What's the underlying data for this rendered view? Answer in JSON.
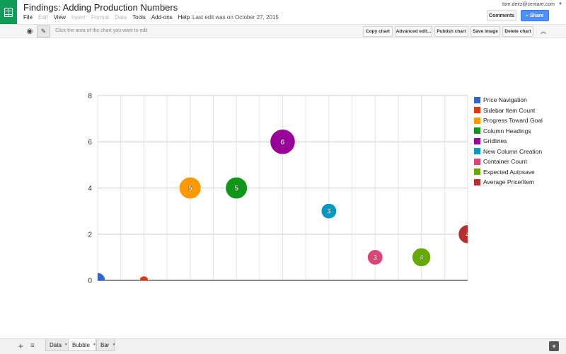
{
  "header": {
    "title": "Findings: Adding Production Numbers",
    "star_icon": "star-icon",
    "drive_icon": "recycle-icon",
    "menus": [
      {
        "label": "File",
        "enabled": true
      },
      {
        "label": "Edit",
        "enabled": false
      },
      {
        "label": "View",
        "enabled": true
      },
      {
        "label": "Insert",
        "enabled": false
      },
      {
        "label": "Format",
        "enabled": false
      },
      {
        "label": "Data",
        "enabled": false
      },
      {
        "label": "Tools",
        "enabled": true
      },
      {
        "label": "Add-ons",
        "enabled": true
      },
      {
        "label": "Help",
        "enabled": true
      }
    ],
    "last_edit": "Last edit was on October 27, 2015",
    "user_email": "tom.deitz@centare.com",
    "comments_label": "Comments",
    "share_label": "Share"
  },
  "chart_toolbar": {
    "hint": "Click the area of the chart you want to edit",
    "buttons": [
      "Copy chart",
      "Advanced edit...",
      "Publish chart",
      "Save image",
      "Delete chart"
    ]
  },
  "chart_data": {
    "type": "scatter",
    "subtype": "bubble",
    "ylim": [
      0,
      8
    ],
    "yticks": [
      "0",
      "2",
      "4",
      "6",
      "8"
    ],
    "x_categories": 16,
    "grid": true,
    "legend_position": "right",
    "series": [
      {
        "name": "Price Navigation",
        "color": "#3366cc",
        "x": 0,
        "y": 0,
        "bubble_label": "",
        "size": 3
      },
      {
        "name": "Sidebar Item Count",
        "color": "#dc3912",
        "x": 2,
        "y": 0,
        "bubble_label": "",
        "size": 1
      },
      {
        "name": "Progress Toward Goal",
        "color": "#ff9900",
        "x": 4,
        "y": 4,
        "bubble_label": "5",
        "size": 5
      },
      {
        "name": "Column Headings",
        "color": "#109618",
        "x": 6,
        "y": 4,
        "bubble_label": "5",
        "size": 5
      },
      {
        "name": "Gridlines",
        "color": "#990099",
        "x": 8,
        "y": 6,
        "bubble_label": "6",
        "size": 6
      },
      {
        "name": "New Column Creation",
        "color": "#0099c6",
        "x": 10,
        "y": 3,
        "bubble_label": "3",
        "size": 3
      },
      {
        "name": "Container Count",
        "color": "#dd4477",
        "x": 12,
        "y": 1,
        "bubble_label": "3",
        "size": 3
      },
      {
        "name": "Expected Autosave",
        "color": "#66aa00",
        "x": 14,
        "y": 1,
        "bubble_label": "4",
        "size": 4
      },
      {
        "name": "Average Price/Item",
        "color": "#b82e2e",
        "x": 16,
        "y": 2,
        "bubble_label": "4",
        "size": 4
      }
    ]
  },
  "bottom_bar": {
    "tabs": [
      {
        "label": "Data",
        "active": false
      },
      {
        "label": "Bubble",
        "active": true
      },
      {
        "label": "Bar",
        "active": false
      }
    ]
  }
}
